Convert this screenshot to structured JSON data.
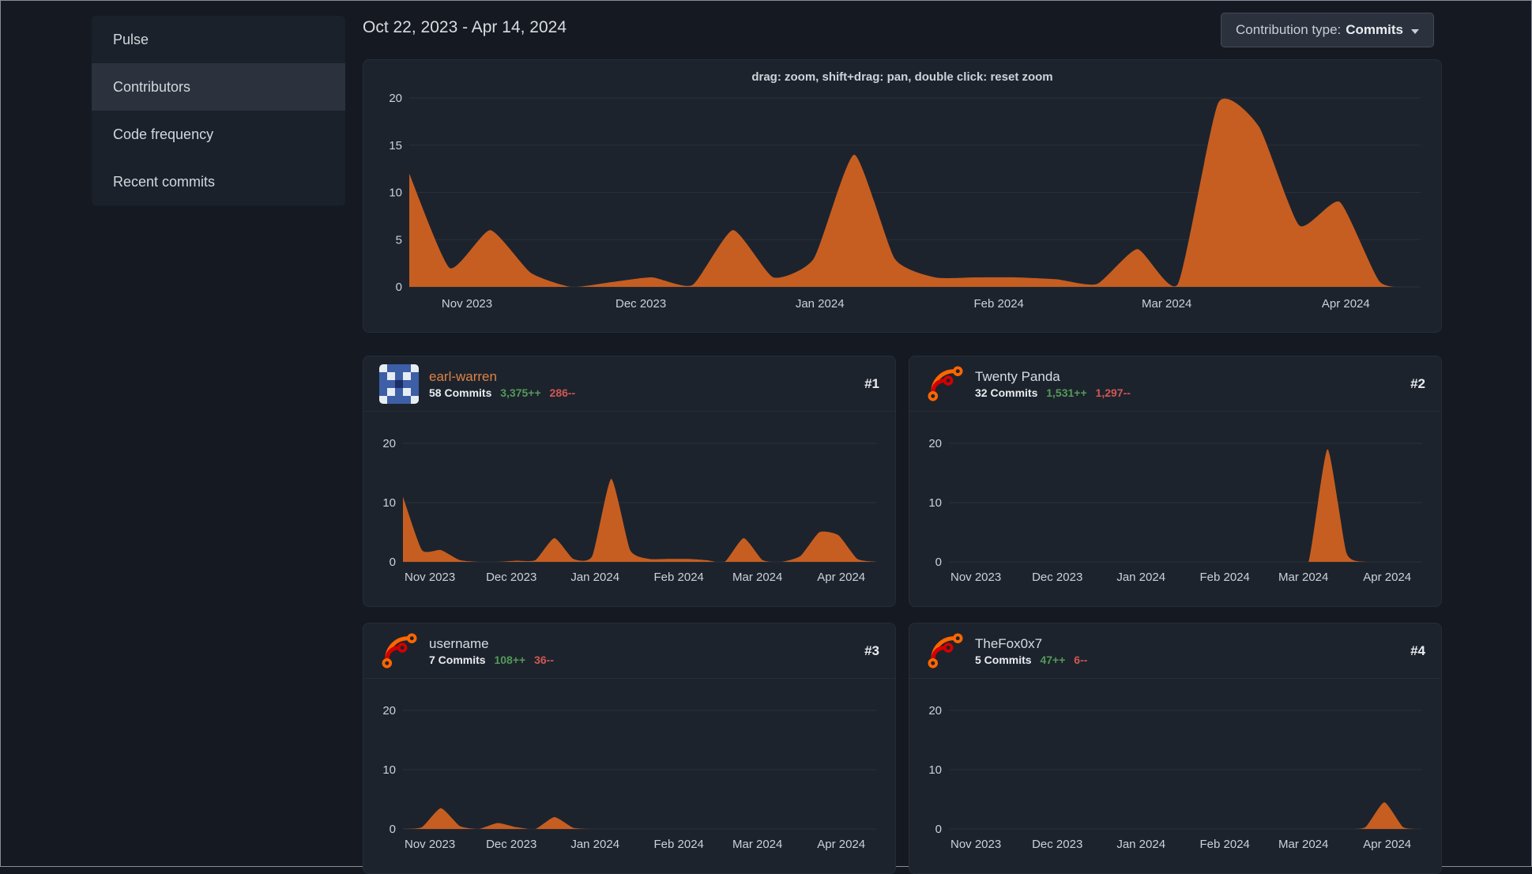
{
  "colors": {
    "page_background": "#151a22",
    "card_background": "#1d232d",
    "chart_fill": "#c65e21",
    "additions_green": "#539a58",
    "deletions_red": "#cf5754",
    "link_orange": "#dd8345"
  },
  "sidebar": {
    "items": [
      {
        "label": "Pulse",
        "active": false
      },
      {
        "label": "Contributors",
        "active": true
      },
      {
        "label": "Code frequency",
        "active": false
      },
      {
        "label": "Recent commits",
        "active": false
      }
    ]
  },
  "header": {
    "date_range": "Oct 22, 2023 - Apr 14, 2024",
    "contribution_type": {
      "label": "Contribution type:",
      "value": "Commits"
    }
  },
  "main_chart_hint": "drag: zoom, shift+drag: pan, double click: reset zoom",
  "contributors": [
    {
      "name": "earl-warren",
      "rank": "#1",
      "commits": "58 Commits",
      "additions": "3,375++",
      "deletions": "286--",
      "avatar": "identicon",
      "name_color": "#dd8345"
    },
    {
      "name": "Twenty Panda",
      "rank": "#2",
      "commits": "32 Commits",
      "additions": "1,531++",
      "deletions": "1,297--",
      "avatar": "forgejo",
      "name_color": "#d8dce2"
    },
    {
      "name": "username",
      "rank": "#3",
      "commits": "7 Commits",
      "additions": "108++",
      "deletions": "36--",
      "avatar": "forgejo",
      "name_color": "#d8dce2"
    },
    {
      "name": "TheFox0x7",
      "rank": "#4",
      "commits": "5 Commits",
      "additions": "47++",
      "deletions": "6--",
      "avatar": "forgejo",
      "name_color": "#d8dce2"
    }
  ],
  "chart_data": [
    {
      "type": "area",
      "x_unit": "week",
      "x_start": "Oct 22, 2023",
      "x_end": "Apr 14, 2024",
      "ylim": [
        0,
        20
      ],
      "yticks": [
        0,
        5,
        10,
        15,
        20
      ],
      "xticks": [
        {
          "label": "Nov 2023",
          "frac": 0.057
        },
        {
          "label": "Dec 2023",
          "frac": 0.229
        },
        {
          "label": "Jan 2024",
          "frac": 0.406
        },
        {
          "label": "Feb 2024",
          "frac": 0.583
        },
        {
          "label": "Mar 2024",
          "frac": 0.749
        },
        {
          "label": "Apr 2024",
          "frac": 0.926
        }
      ],
      "values": [
        12,
        2,
        6,
        1.5,
        0,
        0.5,
        1,
        0.2,
        6,
        1,
        3,
        14,
        3,
        1,
        1,
        1,
        0.8,
        0.3,
        4,
        0.3,
        19.5,
        17,
        6.5,
        9,
        0.5,
        0
      ],
      "color": "#c65e21"
    },
    {
      "type": "area",
      "x_unit": "week",
      "x_start": "Oct 22, 2023",
      "x_end": "Apr 14, 2024",
      "ylim": [
        0,
        20
      ],
      "yticks": [
        0,
        10,
        20
      ],
      "xticks": [
        {
          "label": "Nov 2023",
          "frac": 0.057
        },
        {
          "label": "Dec 2023",
          "frac": 0.229
        },
        {
          "label": "Jan 2024",
          "frac": 0.406
        },
        {
          "label": "Feb 2024",
          "frac": 0.583
        },
        {
          "label": "Mar 2024",
          "frac": 0.749
        },
        {
          "label": "Apr 2024",
          "frac": 0.926
        }
      ],
      "values": [
        11,
        2,
        2,
        0.3,
        0,
        0,
        0.2,
        0.3,
        4,
        0.5,
        1,
        14,
        2,
        0.5,
        0.5,
        0.5,
        0.3,
        0,
        4,
        0.3,
        0,
        1,
        5,
        4.5,
        0.5,
        0
      ],
      "color": "#c65e21"
    },
    {
      "type": "area",
      "x_unit": "week",
      "x_start": "Oct 22, 2023",
      "x_end": "Apr 14, 2024",
      "ylim": [
        0,
        20
      ],
      "yticks": [
        0,
        10,
        20
      ],
      "xticks": [
        {
          "label": "Nov 2023",
          "frac": 0.057
        },
        {
          "label": "Dec 2023",
          "frac": 0.229
        },
        {
          "label": "Jan 2024",
          "frac": 0.406
        },
        {
          "label": "Feb 2024",
          "frac": 0.583
        },
        {
          "label": "Mar 2024",
          "frac": 0.749
        },
        {
          "label": "Apr 2024",
          "frac": 0.926
        }
      ],
      "values": [
        0,
        0,
        0,
        0,
        0,
        0,
        0,
        0,
        0,
        0,
        0,
        0,
        0,
        0,
        0,
        0,
        0,
        0,
        0,
        0,
        19,
        1.5,
        0,
        0,
        0,
        0
      ],
      "color": "#c65e21"
    },
    {
      "type": "area",
      "x_unit": "week",
      "x_start": "Oct 22, 2023",
      "x_end": "Apr 14, 2024",
      "ylim": [
        0,
        20
      ],
      "yticks": [
        0,
        10,
        20
      ],
      "xticks": [
        {
          "label": "Nov 2023",
          "frac": 0.057
        },
        {
          "label": "Dec 2023",
          "frac": 0.229
        },
        {
          "label": "Jan 2024",
          "frac": 0.406
        },
        {
          "label": "Feb 2024",
          "frac": 0.583
        },
        {
          "label": "Mar 2024",
          "frac": 0.749
        },
        {
          "label": "Apr 2024",
          "frac": 0.926
        }
      ],
      "values": [
        0,
        0.3,
        3.5,
        0.5,
        0,
        1,
        0.3,
        0,
        2,
        0.2,
        0,
        0,
        0,
        0,
        0,
        0,
        0,
        0,
        0,
        0,
        0,
        0,
        0,
        0,
        0,
        0
      ],
      "color": "#c65e21"
    },
    {
      "type": "area",
      "x_unit": "week",
      "x_start": "Oct 22, 2023",
      "x_end": "Apr 14, 2024",
      "ylim": [
        0,
        20
      ],
      "yticks": [
        0,
        10,
        20
      ],
      "xticks": [
        {
          "label": "Nov 2023",
          "frac": 0.057
        },
        {
          "label": "Dec 2023",
          "frac": 0.229
        },
        {
          "label": "Jan 2024",
          "frac": 0.406
        },
        {
          "label": "Feb 2024",
          "frac": 0.583
        },
        {
          "label": "Mar 2024",
          "frac": 0.749
        },
        {
          "label": "Apr 2024",
          "frac": 0.926
        }
      ],
      "values": [
        0,
        0,
        0,
        0,
        0,
        0,
        0,
        0,
        0,
        0,
        0,
        0,
        0,
        0,
        0,
        0,
        0,
        0,
        0,
        0,
        0,
        0,
        0.3,
        4.5,
        0.3,
        0
      ],
      "color": "#c65e21"
    }
  ]
}
